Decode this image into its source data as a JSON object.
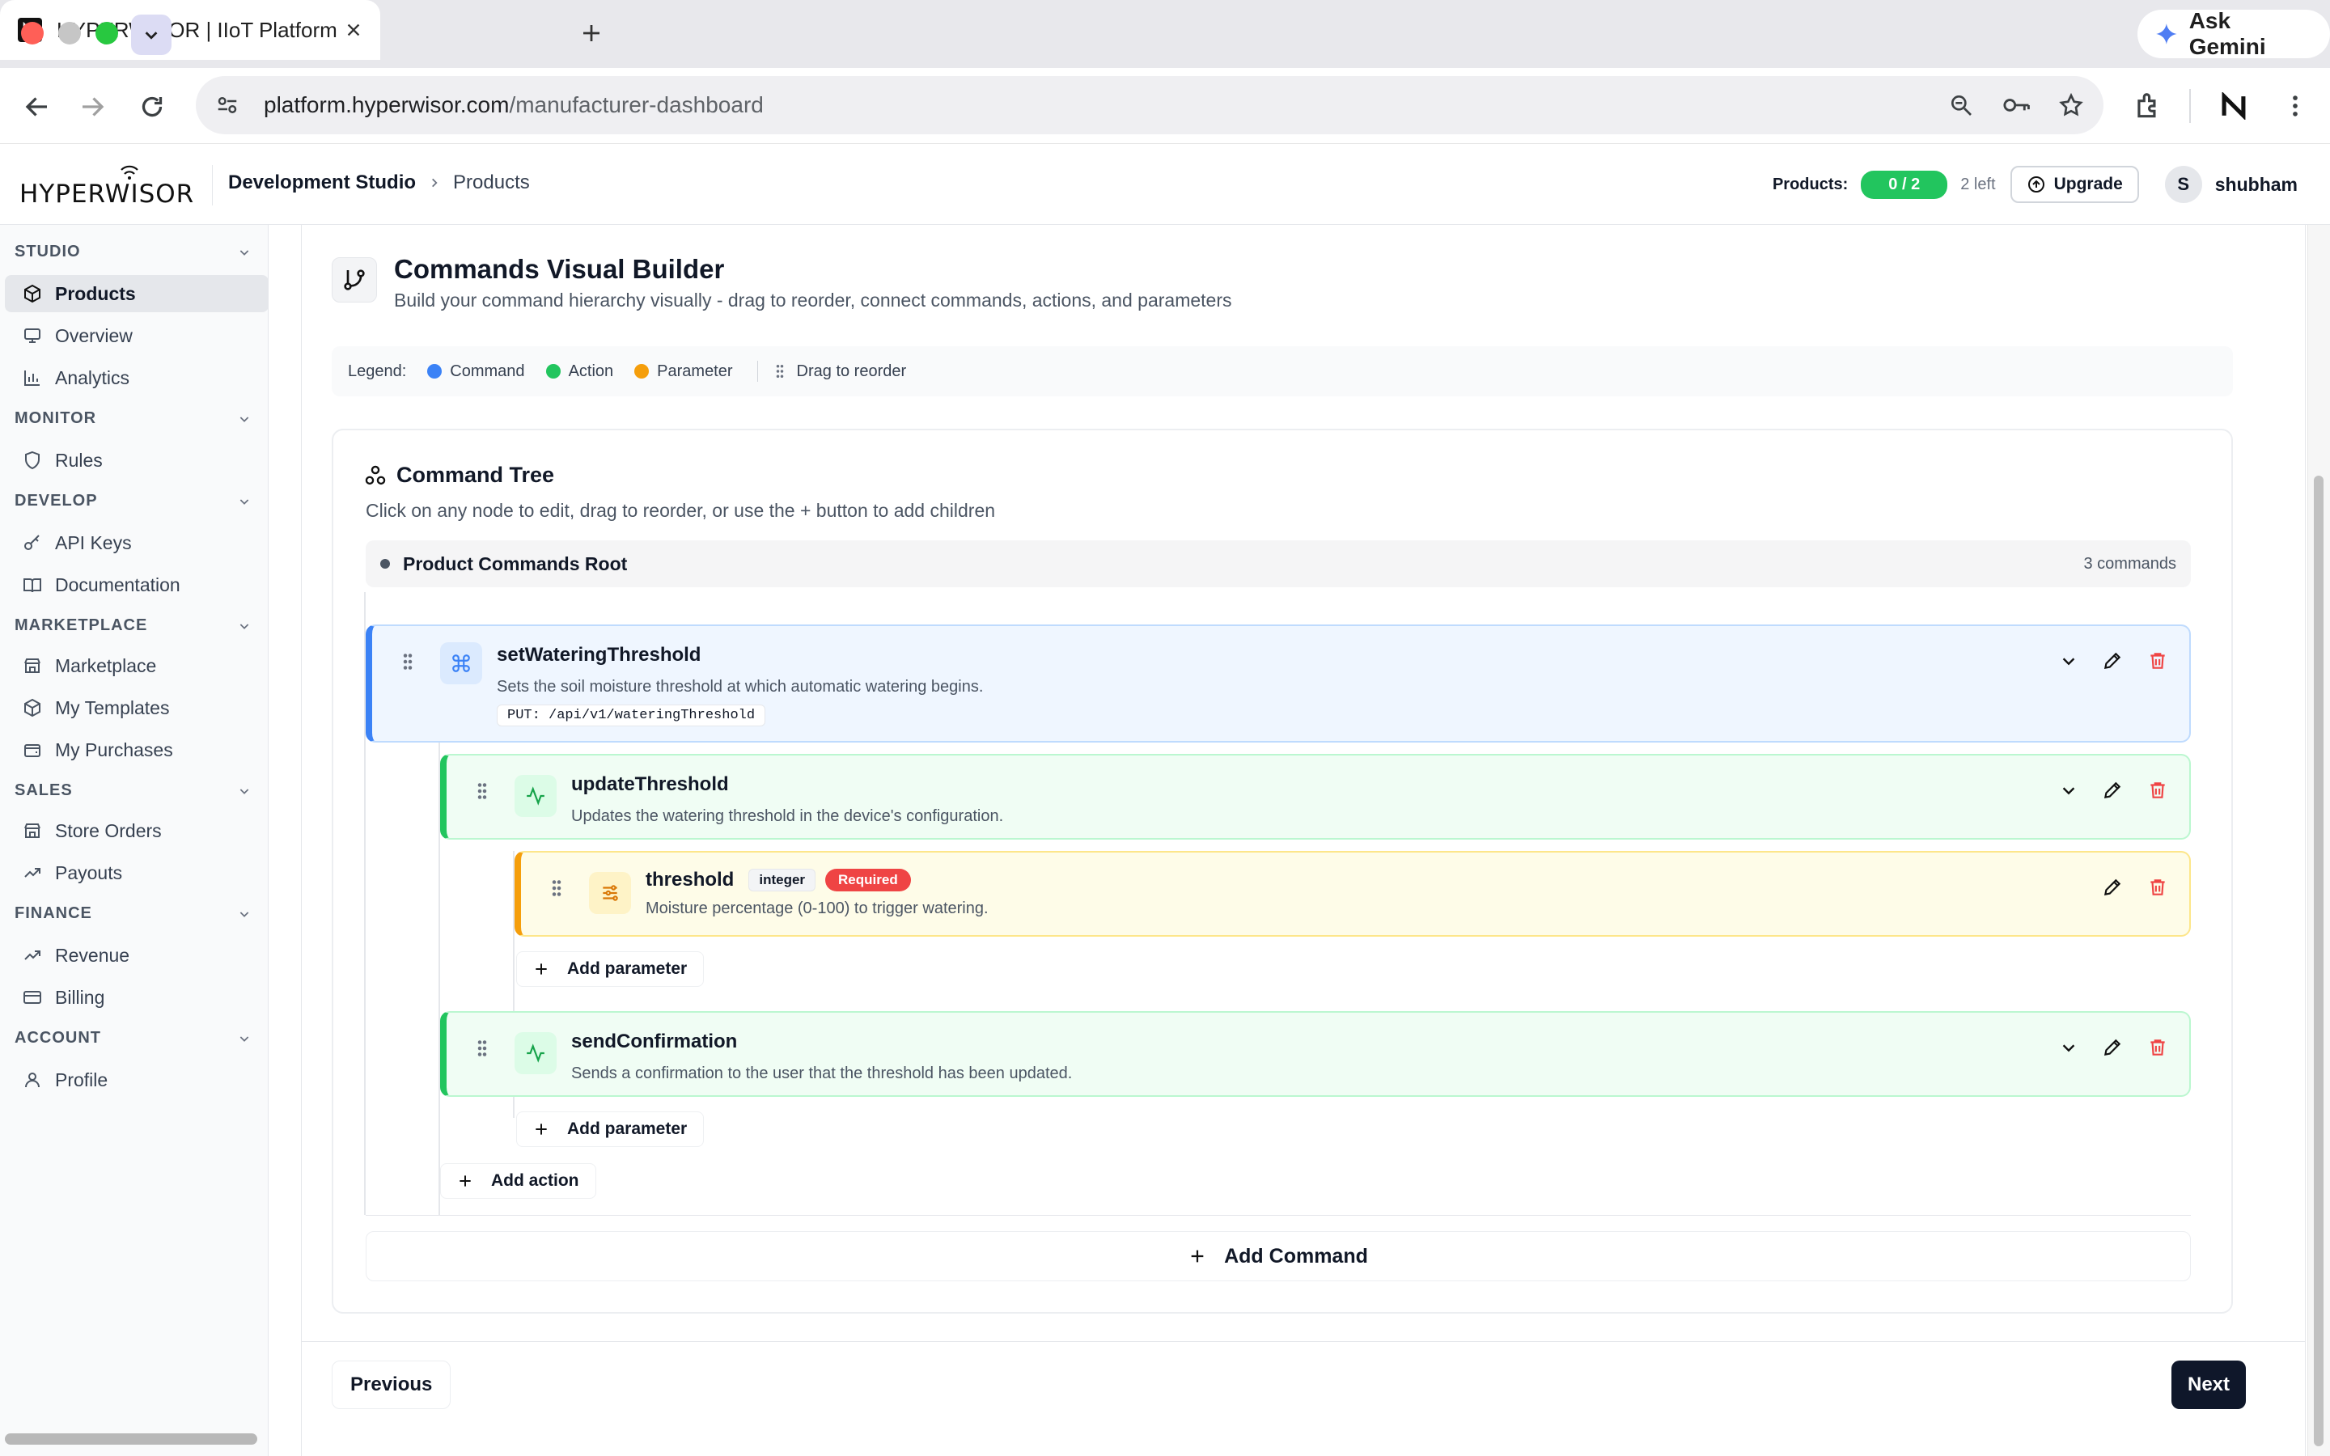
{
  "browser": {
    "tab_title": "HYPERWISOR | IIoT Platform",
    "url_host": "platform.hyperwisor.com",
    "url_path": "/manufacturer-dashboard",
    "ask_gemini": "Ask Gemini"
  },
  "header": {
    "logo_text": "HYPERWISOR",
    "breadcrumb": [
      "Development Studio",
      "Products"
    ],
    "products_label": "Products:",
    "products_count": "0 / 2",
    "products_left": "2 left",
    "upgrade_label": "Upgrade",
    "user_initial": "S",
    "user_name": "shubham"
  },
  "sidebar": {
    "sections": [
      {
        "title": "STUDIO",
        "items": [
          "Products",
          "Overview",
          "Analytics"
        ]
      },
      {
        "title": "MONITOR",
        "items": [
          "Rules"
        ]
      },
      {
        "title": "DEVELOP",
        "items": [
          "API Keys",
          "Documentation"
        ]
      },
      {
        "title": "MARKETPLACE",
        "items": [
          "Marketplace",
          "My Templates",
          "My Purchases"
        ]
      },
      {
        "title": "SALES",
        "items": [
          "Store Orders",
          "Payouts"
        ]
      },
      {
        "title": "FINANCE",
        "items": [
          "Revenue",
          "Billing"
        ]
      },
      {
        "title": "ACCOUNT",
        "items": [
          "Profile"
        ]
      }
    ],
    "active_item": "Products"
  },
  "builder": {
    "title": "Commands Visual Builder",
    "subtitle": "Build your command hierarchy visually - drag to reorder, connect commands, actions, and parameters",
    "legend_label": "Legend:",
    "legend": [
      {
        "label": "Command",
        "color": "#3b82f6"
      },
      {
        "label": "Action",
        "color": "#22c55e"
      },
      {
        "label": "Parameter",
        "color": "#f59e0b"
      }
    ],
    "drag_hint": "Drag to reorder"
  },
  "tree": {
    "title": "Command Tree",
    "subtitle": "Click on any node to edit, drag to reorder, or use the + button to add children",
    "root_label": "Product Commands Root",
    "root_count": "3 commands",
    "command": {
      "name": "setWateringThreshold",
      "description": "Sets the soil moisture threshold at which automatic watering begins.",
      "endpoint": "PUT: /api/v1/wateringThreshold"
    },
    "actions": [
      {
        "name": "updateThreshold",
        "description": "Updates the watering threshold in the device's configuration."
      },
      {
        "name": "sendConfirmation",
        "description": "Sends a confirmation to the user that the threshold has been updated."
      }
    ],
    "parameter": {
      "name": "threshold",
      "type": "integer",
      "required": "Required",
      "description": "Moisture percentage (0-100) to trigger watering."
    },
    "add_parameter": "Add parameter",
    "add_action": "Add action",
    "add_command": "Add Command"
  },
  "footer": {
    "previous": "Previous",
    "next": "Next"
  }
}
